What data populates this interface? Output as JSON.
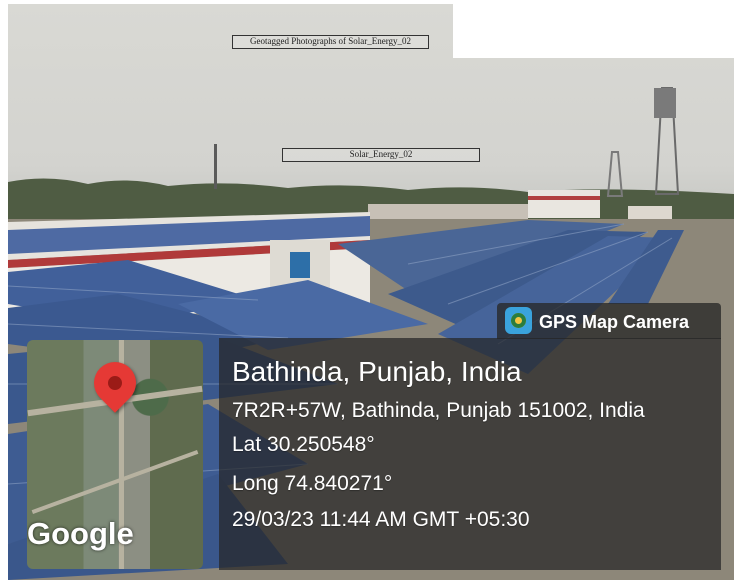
{
  "overlay": {
    "top_caption": "Geotagged Photographs of Solar_Energy_02",
    "mid_caption": "Solar_Energy_02"
  },
  "gps_stamp": {
    "brand": "GPS Map Camera",
    "brand_icon": "gps-map-camera-icon",
    "map_watermark": "Google",
    "city": "Bathinda, Punjab, India",
    "address": "7R2R+57W, Bathinda, Punjab 151002, India",
    "latitude": "Lat 30.250548°",
    "longitude": "Long 74.840271°",
    "datetime": "29/03/23 11:44 AM GMT +05:30",
    "pin_color": "#e53935"
  },
  "scene": {
    "sky_color": "#d6d6d2",
    "panel_color": "#3d5a8c",
    "building_accent": "#b03a3a"
  }
}
